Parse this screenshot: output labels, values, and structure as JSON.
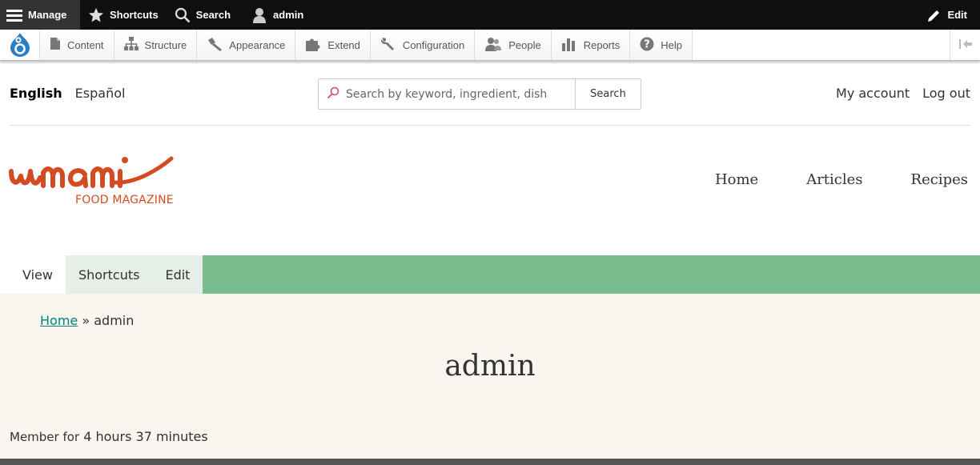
{
  "admin_bar": {
    "manage": "Manage",
    "shortcuts": "Shortcuts",
    "search": "Search",
    "user": "admin",
    "edit": "Edit"
  },
  "tray": {
    "items": [
      {
        "label": "Content",
        "icon": "page-icon"
      },
      {
        "label": "Structure",
        "icon": "sitemap-icon"
      },
      {
        "label": "Appearance",
        "icon": "paintbrush-icon"
      },
      {
        "label": "Extend",
        "icon": "puzzle-icon"
      },
      {
        "label": "Configuration",
        "icon": "wrench-icon"
      },
      {
        "label": "People",
        "icon": "people-icon"
      },
      {
        "label": "Reports",
        "icon": "bar-chart-icon"
      },
      {
        "label": "Help",
        "icon": "help-icon"
      }
    ]
  },
  "header": {
    "languages": {
      "active": "English",
      "other": "Español"
    },
    "search_placeholder": "Search by keyword, ingredient, dish",
    "search_button": "Search",
    "my_account": "My account",
    "log_out": "Log out"
  },
  "brand": {
    "name": "umami",
    "tagline": "FOOD MAGAZINE",
    "color": "#d44a21"
  },
  "main_nav": [
    "Home",
    "Articles",
    "Recipes"
  ],
  "tabs": [
    "View",
    "Shortcuts",
    "Edit"
  ],
  "breadcrumb": {
    "home": "Home",
    "separator": "»",
    "current": "admin"
  },
  "page_title": "admin",
  "member": {
    "label": "Member for",
    "value": "4 hours 37 minutes"
  },
  "colors": {
    "tabs_bg": "#79bd8f",
    "content_bg": "#f9f5ef",
    "link": "#00827f"
  }
}
